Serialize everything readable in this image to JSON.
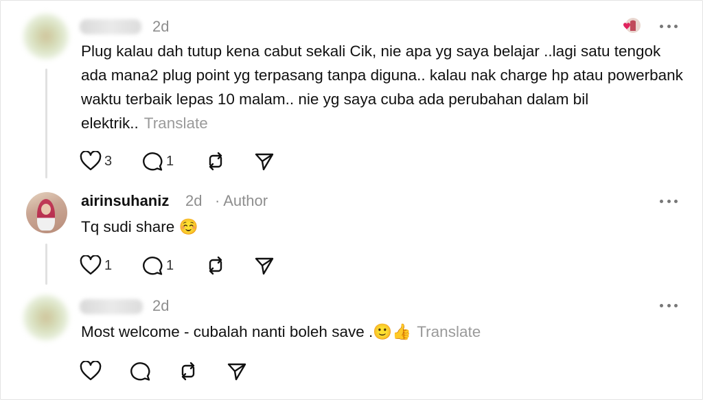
{
  "comments": [
    {
      "time": "2d",
      "text": "Plug kalau dah tutup kena cabut sekali Cik, nie apa yg saya belajar ..lagi satu tengok ada mana2 plug point yg terpasang tanpa diguna.. kalau nak charge hp atau powerbank waktu terbaik lepas 10 malam.. nie yg saya cuba ada perubahan dalam bil elektrik..",
      "translate": "Translate",
      "likes": "3",
      "replies": "1"
    },
    {
      "username": "airinsuhaniz",
      "time": "2d",
      "author_tag": "· Author",
      "text": "Tq sudi share ☺️",
      "likes": "1",
      "replies": "1"
    },
    {
      "time": "2d",
      "text": "Most welcome - cubalah nanti boleh save .🙂👍",
      "translate": "Translate"
    }
  ],
  "icons": {
    "like": "heart-icon",
    "reply": "comment-icon",
    "repost": "repost-icon",
    "share": "send-icon",
    "more": "more-options-icon"
  },
  "colors": {
    "heart_red": "#e0245e",
    "muted": "#8e8e8e"
  }
}
